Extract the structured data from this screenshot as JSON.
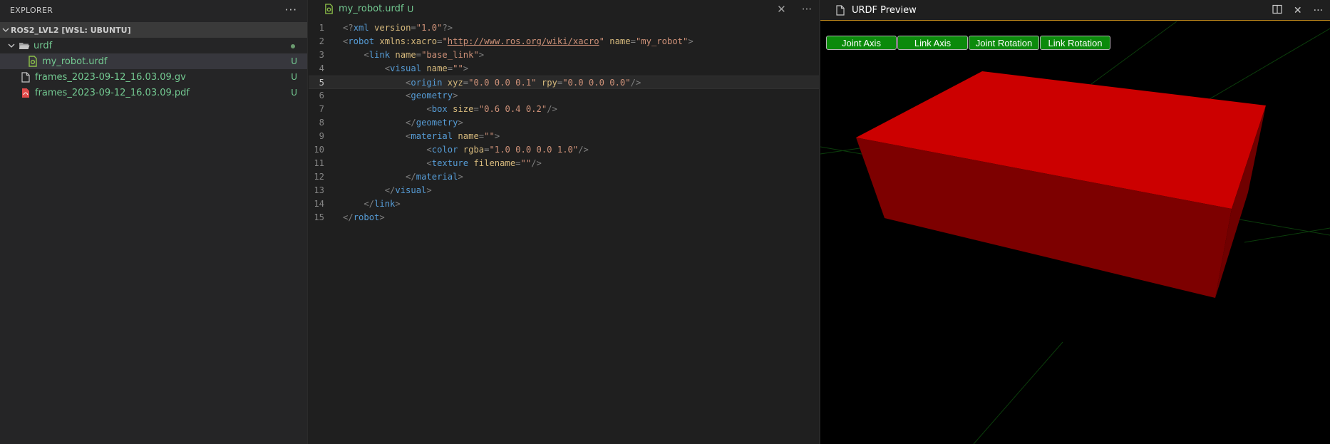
{
  "explorer": {
    "title": "EXPLORER",
    "more_label": "···",
    "workspace_label": "ROS2_LVL2 [WSL: UBUNTU]",
    "items": [
      {
        "name": "urdf",
        "kind": "folder",
        "status": ""
      },
      {
        "name": "my_robot.urdf",
        "kind": "urdf-file",
        "status": "U"
      },
      {
        "name": "frames_2023-09-12_16.03.09.gv",
        "kind": "file",
        "status": "U"
      },
      {
        "name": "frames_2023-09-12_16.03.09.pdf",
        "kind": "pdf-file",
        "status": "U"
      }
    ]
  },
  "editor": {
    "tab_title": "my_robot.urdf",
    "tab_status": "U",
    "close_label": "✕",
    "more_label": "···",
    "line_numbers": [
      "1",
      "2",
      "3",
      "4",
      "5",
      "6",
      "7",
      "8",
      "9",
      "10",
      "11",
      "12",
      "13",
      "14",
      "15"
    ],
    "current_line": 5
  },
  "preview": {
    "tab_title": "URDF Preview",
    "buttons": [
      "Joint Axis",
      "Link Axis",
      "Joint Rotation",
      "Link Rotation"
    ],
    "close_label": "✕",
    "more_label": "···",
    "colors": {
      "box_top": "#cc0000",
      "box_left": "#7d0000",
      "box_front": "#730000",
      "grid": "#0b3d0b",
      "button": "#0b8a0b"
    }
  },
  "code": {
    "l1": [
      "<?",
      "xml",
      " version",
      "=",
      "\"1.0\"",
      "?>"
    ],
    "l2": [
      "<",
      "robot",
      " xmlns:xacro",
      "=",
      "\"",
      "http://www.ros.org/wiki/xacro",
      "\"",
      " name",
      "=",
      "\"my_robot\"",
      ">"
    ],
    "l3": [
      "    <",
      "link",
      " name",
      "=",
      "\"base_link\"",
      ">"
    ],
    "l4": [
      "        <",
      "visual",
      " name",
      "=",
      "\"\"",
      ">"
    ],
    "l5": [
      "            <",
      "origin",
      " xyz",
      "=",
      "\"0.0 0.0 0.1\"",
      " rpy",
      "=",
      "\"0.0 0.0 0.0\"",
      "/>"
    ],
    "l6": [
      "            <",
      "geometry",
      ">"
    ],
    "l7": [
      "                <",
      "box",
      " size",
      "=",
      "\"0.6 0.4 0.2\"",
      "/>"
    ],
    "l8": [
      "            </",
      "geometry",
      ">"
    ],
    "l9": [
      "            <",
      "material",
      " name",
      "=",
      "\"\"",
      ">"
    ],
    "l10": [
      "                <",
      "color",
      " rgba",
      "=",
      "\"1.0 0.0 0.0 1.0\"",
      "/>"
    ],
    "l11": [
      "                <",
      "texture",
      " filename",
      "=",
      "\"\"",
      "/>"
    ],
    "l12": [
      "            </",
      "material",
      ">"
    ],
    "l13": [
      "        </",
      "visual",
      ">"
    ],
    "l14": [
      "    </",
      "link",
      ">"
    ],
    "l15": [
      "</",
      "robot",
      ">"
    ]
  }
}
